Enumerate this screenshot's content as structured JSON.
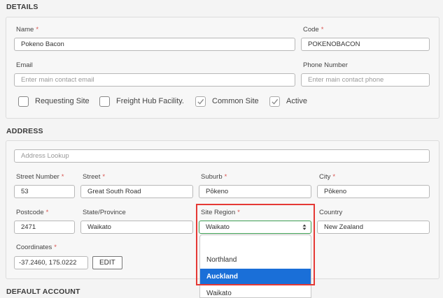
{
  "details": {
    "title": "DETAILS",
    "name_label": "Name",
    "name_value": "Pokeno Bacon",
    "code_label": "Code",
    "code_value": "POKENOBACON",
    "email_label": "Email",
    "email_placeholder": "Enter main contact email",
    "phone_label": "Phone Number",
    "phone_placeholder": "Enter main contact phone",
    "checkboxes": [
      {
        "label": "Requesting Site",
        "checked": false
      },
      {
        "label": "Freight Hub Facility.",
        "checked": false
      },
      {
        "label": "Common Site",
        "checked": true
      },
      {
        "label": "Active",
        "checked": true
      }
    ]
  },
  "address": {
    "title": "ADDRESS",
    "lookup_placeholder": "Address Lookup",
    "street_number_label": "Street Number",
    "street_number_value": "53",
    "street_label": "Street",
    "street_value": "Great South Road",
    "suburb_label": "Suburb",
    "suburb_value": "Pōkeno",
    "city_label": "City",
    "city_value": "Pōkeno",
    "postcode_label": "Postcode",
    "postcode_value": "2471",
    "state_label": "State/Province",
    "state_value": "Waikato",
    "region_label": "Site Region",
    "region_value": "Waikato",
    "country_label": "Country",
    "country_value": "New Zealand",
    "coordinates_label": "Coordinates",
    "coordinates_value": "-37.2460, 175.0222",
    "edit_label": "EDIT",
    "region_options": [
      "",
      "Northland",
      "Auckland",
      "Waikato"
    ],
    "region_highlighted": "Auckland"
  },
  "default_account": {
    "title": "DEFAULT ACCOUNT"
  },
  "colors": {
    "required": "#d9534f",
    "highlight_border": "#e53935",
    "selected_option": "#1a6fd8",
    "focus_border": "#3d9e53"
  }
}
